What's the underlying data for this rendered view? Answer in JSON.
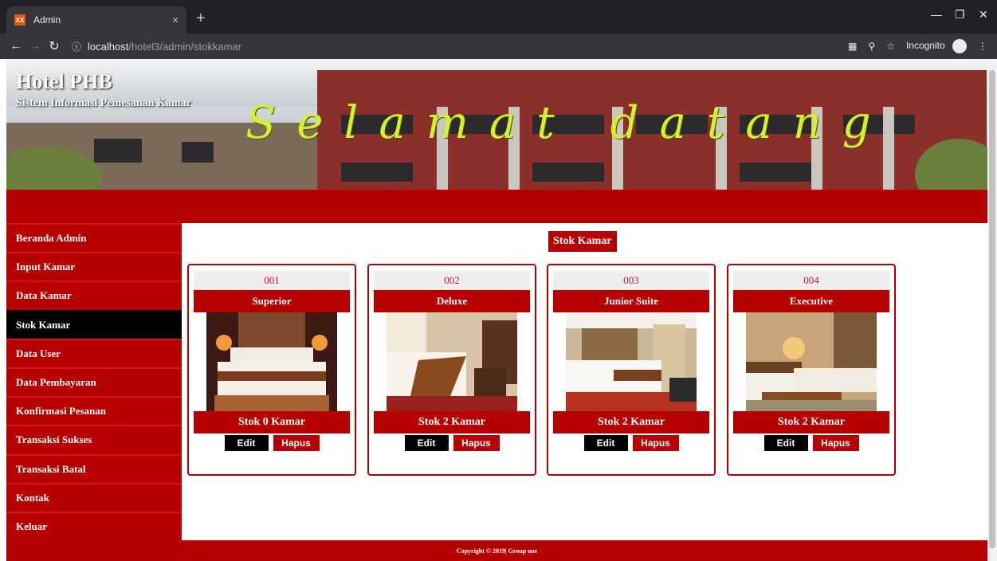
{
  "browser": {
    "tab_title": "Admin",
    "tab_close": "×",
    "new_tab": "+",
    "url_host": "localhost",
    "url_path": "/hotel3/admin/stokkamar",
    "incognito_label": "Incognito"
  },
  "header": {
    "site_title": "Hotel PHB",
    "site_subtitle": "Sistem Informasi Pemesanan Kamar",
    "welcome_text": "Selamat datang"
  },
  "sidebar": {
    "items": [
      {
        "label": "Beranda Admin"
      },
      {
        "label": "Input Kamar"
      },
      {
        "label": "Data Kamar"
      },
      {
        "label": "Stok Kamar",
        "active": true
      },
      {
        "label": "Data User"
      },
      {
        "label": "Data Pembayaran"
      },
      {
        "label": "Konfirmasi Pesanan"
      },
      {
        "label": "Transaksi Sukses"
      },
      {
        "label": "Transaksi Batal"
      },
      {
        "label": "Kontak"
      },
      {
        "label": "Keluar"
      }
    ]
  },
  "main": {
    "section_title": "Stok Kamar",
    "cards": [
      {
        "code": "001",
        "type": "Superior",
        "stock": "Stok 0 Kamar",
        "edit": "Edit",
        "delete": "Hapus"
      },
      {
        "code": "002",
        "type": "Deluxe",
        "stock": "Stok 2 Kamar",
        "edit": "Edit",
        "delete": "Hapus"
      },
      {
        "code": "003",
        "type": "Junior Suite",
        "stock": "Stok 2 Kamar",
        "edit": "Edit",
        "delete": "Hapus"
      },
      {
        "code": "004",
        "type": "Executive",
        "stock": "Stok 2 Kamar",
        "edit": "Edit",
        "delete": "Hapus"
      }
    ]
  },
  "footer": {
    "text": "Copyright © 2019| Group one"
  },
  "colors": {
    "brand_red": "#b70000",
    "active_nav": "#000000",
    "welcome_yellow": "#d6ef2e"
  }
}
